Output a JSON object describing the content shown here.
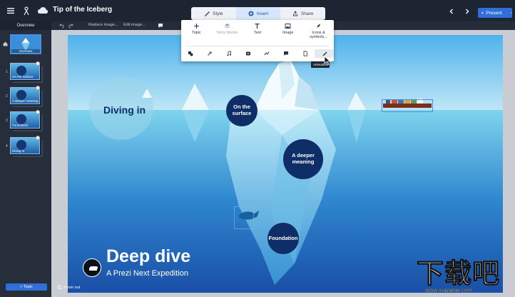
{
  "app": {
    "title": "Tip of the Iceberg",
    "tabs": [
      {
        "label": "Style",
        "icon": "brush-icon"
      },
      {
        "label": "Insert",
        "icon": "plus-circle-icon",
        "active": true
      },
      {
        "label": "Share",
        "icon": "share-icon"
      }
    ],
    "present_label": "Present",
    "accent": "#2f6fd6"
  },
  "subbar": {
    "overview_label": "Overview",
    "replace_image": "Replace image...",
    "edit_image": "Edit image..."
  },
  "sidebar": {
    "overview_label": "Overview",
    "slides": [
      {
        "num": "1",
        "caption": "On the surface"
      },
      {
        "num": "2",
        "caption": "A deeper meaning"
      },
      {
        "num": "3",
        "caption": "Foundation"
      },
      {
        "num": "4",
        "caption": "Diving in"
      }
    ],
    "topic_button": "+ Topic"
  },
  "insert_panel": {
    "items": [
      {
        "label": "Topic",
        "icon": "plus-icon"
      },
      {
        "label": "Story blocks",
        "icon": "layers-icon",
        "disabled": true
      },
      {
        "label": "Text",
        "icon": "text-icon"
      },
      {
        "label": "Image",
        "icon": "image-icon"
      },
      {
        "label": "Icons & symbols...",
        "icon": "pen-nib-icon"
      }
    ],
    "tools": [
      "shapes-icon",
      "arrow-icon",
      "music-icon",
      "video-icon",
      "chart-icon",
      "comment-icon",
      "document-icon",
      "highlighter-icon"
    ],
    "tooltip": "Animation"
  },
  "slide": {
    "topics": [
      "On the surface",
      "A deeper meaning",
      "Foundation"
    ],
    "diving_in": "Diving in",
    "title": "Deep dive",
    "subtitle": "A Prezi Next Expedition"
  },
  "footer": {
    "zoom_out": "Zoom out"
  },
  "watermark": {
    "big": "下载吧",
    "small": "www.xiazaiba.com"
  }
}
